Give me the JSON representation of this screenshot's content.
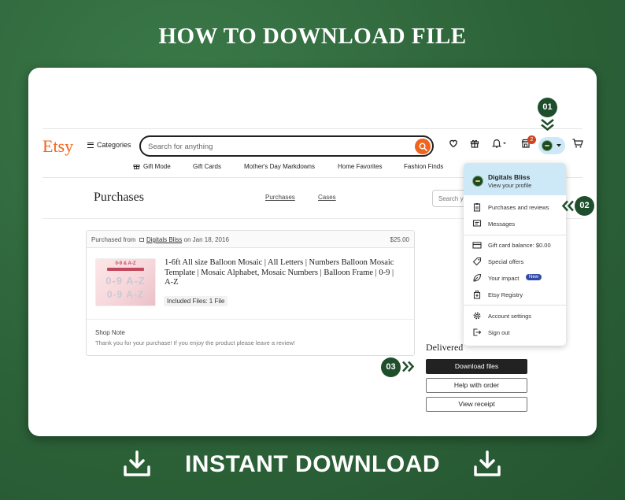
{
  "headline": "HOW TO DOWNLOAD FILE",
  "footer": "INSTANT DOWNLOAD",
  "header": {
    "logo": "Etsy",
    "categories_label": "Categories",
    "search_placeholder": "Search for anything",
    "cart_badge_count": "2"
  },
  "nav_links": [
    "Gift Mode",
    "Gift Cards",
    "Mother's Day Markdowns",
    "Home Favorites",
    "Fashion Finds"
  ],
  "purchases": {
    "title": "Purchases",
    "tabs": [
      "Purchases",
      "Cases"
    ],
    "search_placeholder": "Search yo"
  },
  "order": {
    "purchased_from_prefix": "Purchased from",
    "shop": "Digitals Bliss",
    "date_text": "on Jan 18, 2016",
    "price": "$25.00",
    "product_title": "1-6ft All size Balloon Mosaic | All Letters | Numbers Balloon Mosaic Template | Mosaic Alphabet, Mosaic Numbers | Balloon Frame | 0-9 | A-Z",
    "included_files": "Included Files: 1 File",
    "thumbnail": {
      "heading": "0-9 & A-Z",
      "subheading": "MOSAIC TEMPLATES BUNDLE",
      "line1": "0-9 A-Z",
      "line2": "0-9 A-Z"
    },
    "shop_note_label": "Shop Note",
    "shop_note_text": "Thank you for your purchase! If you enjoy the product please leave a review!",
    "status": "Delivered",
    "buttons": {
      "download": "Download files",
      "help": "Help with order",
      "receipt": "View receipt"
    }
  },
  "account_menu": {
    "name": "Digitals Bliss",
    "view_profile": "View your profile",
    "items": [
      {
        "label": "Purchases and reviews",
        "icon": "clipboard-icon"
      },
      {
        "label": "Messages",
        "icon": "message-icon"
      },
      {
        "label": "Gift card balance: $0.00",
        "icon": "gift-card-icon"
      },
      {
        "label": "Special offers",
        "icon": "tag-icon"
      },
      {
        "label": "Your impact",
        "icon": "leaf-icon",
        "badge": "New"
      },
      {
        "label": "Etsy Registry",
        "icon": "registry-icon"
      },
      {
        "label": "Account settings",
        "icon": "gear-icon"
      },
      {
        "label": "Sign out",
        "icon": "sign-out-icon"
      }
    ]
  },
  "steps": [
    "01",
    "02",
    "03"
  ],
  "colors": {
    "background": "#2f6b3e",
    "etsy_orange": "#f1641e",
    "step_badge": "#1f4e2c",
    "menu_highlight": "#cde9f8"
  }
}
